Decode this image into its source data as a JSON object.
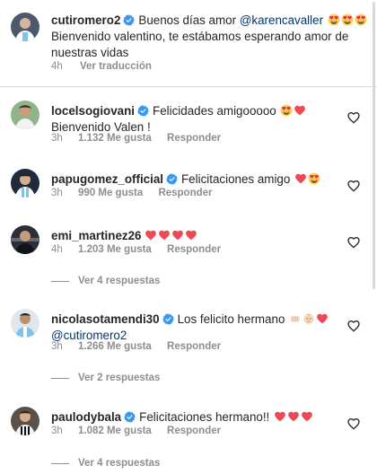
{
  "caption": {
    "username": "cutiromero2",
    "text": "Buenos días amor",
    "mention": "@karencavaller",
    "text2": "Bienvenido valentino, te estábamos esperando amor de nuestras vidas",
    "time": "4h",
    "translate_label": "Ver traducción"
  },
  "comments": [
    {
      "username": "locelsogiovani",
      "text": "Felicidades amigooooo",
      "text2": "Bienvenido Valen !",
      "time": "3h",
      "likes": "1.132 Me gusta",
      "reply_label": "Responder"
    },
    {
      "username": "papugomez_official",
      "text": "Felicitaciones amigo",
      "time": "3h",
      "likes": "990 Me gusta",
      "reply_label": "Responder"
    },
    {
      "username": "emi_martinez26",
      "text": "",
      "time": "4h",
      "likes": "1.203 Me gusta",
      "reply_label": "Responder",
      "replies_label": "Ver 4 respuestas"
    },
    {
      "username": "nicolasotamendi30",
      "text": "Los felicito hermano",
      "mention": "@cutiromero2",
      "time": "3h",
      "likes": "1.266 Me gusta",
      "reply_label": "Responder",
      "replies_label": "Ver 2 respuestas"
    },
    {
      "username": "paulodybala",
      "text": "Felicitaciones hermano!!",
      "time": "3h",
      "likes": "1.082 Me gusta",
      "reply_label": "Responder",
      "replies_label": "Ver 4 respuestas"
    }
  ],
  "colors": {
    "verified": "#3897f0",
    "heart": "#ed4956",
    "muted": "#8e8e8e",
    "mention": "#00376b"
  }
}
